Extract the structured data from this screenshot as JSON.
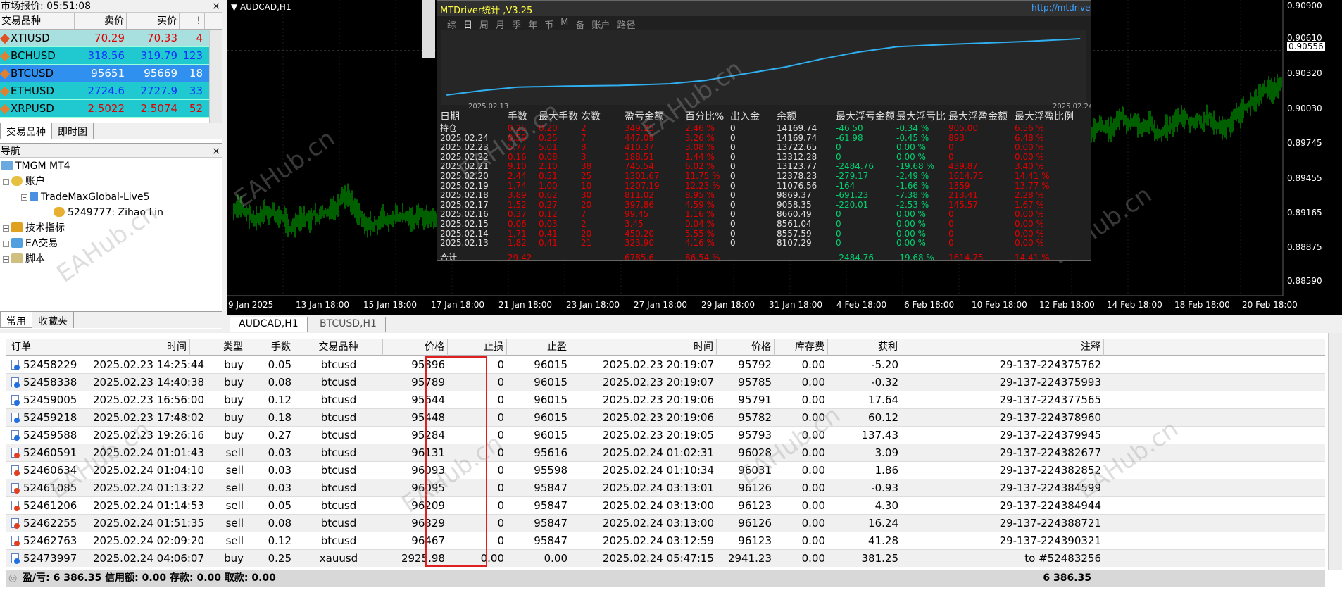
{
  "market_watch": {
    "title": "市场报价: 05:51:08",
    "close": "×",
    "headers": [
      "交易品种",
      "卖价",
      "买价",
      "!"
    ],
    "rows": [
      {
        "symbol": "XTIUSD",
        "bid": "70.29",
        "ask": "70.33",
        "spread": "4",
        "bg": "#a8e0e0",
        "color": "#e00000"
      },
      {
        "symbol": "BCHUSD",
        "bid": "318.56",
        "ask": "319.79",
        "spread": "123",
        "bg": "#20c8d0",
        "color": "#1030ff"
      },
      {
        "symbol": "BTCUSD",
        "bid": "95651",
        "ask": "95669",
        "spread": "18",
        "bg": "#3090f0",
        "color": "#ffffff"
      },
      {
        "symbol": "ETHUSD",
        "bid": "2724.6",
        "ask": "2727.9",
        "spread": "33",
        "bg": "#20c8d0",
        "color": "#1030ff"
      },
      {
        "symbol": "XRPUSD",
        "bid": "2.5022",
        "ask": "2.5074",
        "spread": "52",
        "bg": "#20c8d0",
        "color": "#e00000"
      }
    ],
    "tabs": [
      "交易品种",
      "即时图"
    ]
  },
  "navigator": {
    "title": "导航",
    "close": "×",
    "items": [
      {
        "label": "TMGM MT4"
      },
      {
        "label": "账户"
      },
      {
        "label": "TradeMaxGlobal-Live5"
      },
      {
        "label": "5249777: Zihao Lin"
      },
      {
        "label": "技术指标"
      },
      {
        "label": "EA交易"
      },
      {
        "label": "脚本"
      }
    ],
    "tabs": [
      "常用",
      "收藏夹"
    ]
  },
  "chart": {
    "symbol_label": "AUDCAD,H1",
    "price_scale": [
      "0.90900",
      "0.90610",
      "0.90556",
      "0.90320",
      "0.90030",
      "0.89745",
      "0.89455",
      "0.89165",
      "0.88875",
      "0.88590"
    ],
    "time_scale": [
      "9 Jan 2025",
      "13 Jan 18:00",
      "15 Jan 18:00",
      "17 Jan 18:00",
      "21 Jan 18:00",
      "23 Jan 18:00",
      "27 Jan 18:00",
      "29 Jan 18:00",
      "31 Jan 18:00",
      "4 Feb 18:00",
      "6 Feb 18:00",
      "10 Feb 18:00",
      "12 Feb 18:00",
      "14 Feb 18:00",
      "18 Feb 18:00",
      "20 Feb 18:00"
    ],
    "tabs": [
      "AUDCAD,H1",
      "BTCUSD,H1"
    ],
    "watermark": "EAHub.cn"
  },
  "stats": {
    "title": "MTDriver统计 ,V3.25",
    "link": "http://mtdriver.cn",
    "menu": [
      "综",
      "日",
      "周",
      "月",
      "季",
      "年",
      "币",
      "M",
      "备",
      "账户",
      "路径"
    ],
    "curve_start": "2025.02.13",
    "curve_end": "2025.02.24",
    "headers": [
      "日期",
      "手数",
      "最大手数",
      "次数",
      "盈亏金额",
      "百分比%",
      "出入金",
      "余额",
      "最大浮亏金额",
      "最大浮亏比",
      "最大浮盈金额",
      "最大浮盈比例"
    ],
    "rows": [
      [
        "持仓",
        "0.25",
        "0.20",
        "2",
        "349.25",
        "2.46 %",
        "0",
        "14169.74",
        "-46.50",
        "-0.34 %",
        "905.00",
        "6.56 %"
      ],
      [
        "2025.02.24",
        "0.59",
        "0.25",
        "7",
        "447.09",
        "3.26 %",
        "0",
        "14169.74",
        "-61.98",
        "-0.45 %",
        "893",
        "6.48 %"
      ],
      [
        "2025.02.23",
        "5.77",
        "5.01",
        "8",
        "410.37",
        "3.08 %",
        "0",
        "13722.65",
        "0",
        "0.00 %",
        "0",
        "0.00 %"
      ],
      [
        "2025.02.22",
        "0.16",
        "0.08",
        "3",
        "188.51",
        "1.44 %",
        "0",
        "13312.28",
        "0",
        "0.00 %",
        "0",
        "0.00 %"
      ],
      [
        "2025.02.21",
        "9.10",
        "2.10",
        "38",
        "745.54",
        "6.02 %",
        "0",
        "13123.77",
        "-2484.76",
        "-19.68 %",
        "439.87",
        "3.40 %"
      ],
      [
        "2025.02.20",
        "2.44",
        "0.51",
        "25",
        "1301.67",
        "11.75 %",
        "0",
        "12378.23",
        "-279.17",
        "-2.49 %",
        "1614.75",
        "14.41 %"
      ],
      [
        "2025.02.19",
        "1.74",
        "1.00",
        "10",
        "1207.19",
        "12.23 %",
        "0",
        "11076.56",
        "-164",
        "-1.66 %",
        "1359",
        "13.77 %"
      ],
      [
        "2025.02.18",
        "3.89",
        "0.62",
        "30",
        "811.02",
        "8.95 %",
        "0",
        "9869.37",
        "-691.23",
        "-7.38 %",
        "213.41",
        "2.28 %"
      ],
      [
        "2025.02.17",
        "1.52",
        "0.27",
        "20",
        "397.86",
        "4.59 %",
        "0",
        "9058.35",
        "-220.01",
        "-2.53 %",
        "145.57",
        "1.67 %"
      ],
      [
        "2025.02.16",
        "0.37",
        "0.12",
        "7",
        "99.45",
        "1.16 %",
        "0",
        "8660.49",
        "0",
        "0.00 %",
        "0",
        "0.00 %"
      ],
      [
        "2025.02.15",
        "0.06",
        "0.03",
        "2",
        "3.45",
        "0.04 %",
        "0",
        "8561.04",
        "0",
        "0.00 %",
        "0",
        "0.00 %"
      ],
      [
        "2025.02.14",
        "1.71",
        "0.41",
        "20",
        "450.20",
        "5.55 %",
        "0",
        "8557.59",
        "0",
        "0.00 %",
        "0",
        "0.00 %"
      ],
      [
        "2025.02.13",
        "1.82",
        "0.41",
        "21",
        "323.90",
        "4.16 %",
        "0",
        "8107.29",
        "0",
        "0.00 %",
        "0",
        "0.00 %"
      ]
    ],
    "total": [
      "合计",
      "29.42",
      "",
      "",
      "6785.6",
      "86.54 %",
      "",
      "",
      "-2484.76",
      "-19.68 %",
      "1614.75",
      "14.41 %"
    ]
  },
  "terminal": {
    "headers": [
      "订单",
      "时间",
      "类型",
      "手数",
      "交易品种",
      "价格",
      "止损",
      "止盈",
      "时间",
      "价格",
      "库存费",
      "获利",
      "注释"
    ],
    "rows": [
      [
        "52458229",
        "2025.02.23 14:25:44",
        "buy",
        "0.05",
        "btcusd",
        "95896",
        "0",
        "96015",
        "2025.02.23 20:19:07",
        "95792",
        "0.00",
        "-5.20",
        "29-137-224375762"
      ],
      [
        "52458338",
        "2025.02.23 14:40:38",
        "buy",
        "0.08",
        "btcusd",
        "95789",
        "0",
        "96015",
        "2025.02.23 20:19:07",
        "95785",
        "0.00",
        "-0.32",
        "29-137-224375993"
      ],
      [
        "52459005",
        "2025.02.23 16:56:00",
        "buy",
        "0.12",
        "btcusd",
        "95644",
        "0",
        "96015",
        "2025.02.23 20:19:06",
        "95791",
        "0.00",
        "17.64",
        "29-137-224377565"
      ],
      [
        "52459218",
        "2025.02.23 17:48:02",
        "buy",
        "0.18",
        "btcusd",
        "95448",
        "0",
        "96015",
        "2025.02.23 20:19:06",
        "95782",
        "0.00",
        "60.12",
        "29-137-224378960"
      ],
      [
        "52459588",
        "2025.02.23 19:26:16",
        "buy",
        "0.27",
        "btcusd",
        "95284",
        "0",
        "96015",
        "2025.02.23 20:19:05",
        "95793",
        "0.00",
        "137.43",
        "29-137-224379945"
      ],
      [
        "52460591",
        "2025.02.24 01:01:43",
        "sell",
        "0.03",
        "btcusd",
        "96131",
        "0",
        "95616",
        "2025.02.24 01:02:31",
        "96028",
        "0.00",
        "3.09",
        "29-137-224382677"
      ],
      [
        "52460634",
        "2025.02.24 01:04:10",
        "sell",
        "0.03",
        "btcusd",
        "96093",
        "0",
        "95598",
        "2025.02.24 01:10:34",
        "96031",
        "0.00",
        "1.86",
        "29-137-224382852"
      ],
      [
        "52461085",
        "2025.02.24 01:13:22",
        "sell",
        "0.03",
        "btcusd",
        "96095",
        "0",
        "95847",
        "2025.02.24 03:13:01",
        "96126",
        "0.00",
        "-0.93",
        "29-137-224384599"
      ],
      [
        "52461206",
        "2025.02.24 01:14:53",
        "sell",
        "0.05",
        "btcusd",
        "96209",
        "0",
        "95847",
        "2025.02.24 03:13:00",
        "96123",
        "0.00",
        "4.30",
        "29-137-224384944"
      ],
      [
        "52462255",
        "2025.02.24 01:51:35",
        "sell",
        "0.08",
        "btcusd",
        "96329",
        "0",
        "95847",
        "2025.02.24 03:13:00",
        "96126",
        "0.00",
        "16.24",
        "29-137-224388721"
      ],
      [
        "52462763",
        "2025.02.24 02:09:20",
        "sell",
        "0.12",
        "btcusd",
        "96467",
        "0",
        "95847",
        "2025.02.24 03:12:59",
        "96123",
        "0.00",
        "41.28",
        "29-137-224390321"
      ],
      [
        "52473997",
        "2025.02.24 04:06:07",
        "buy",
        "0.25",
        "xauusd",
        "2925.98",
        "0.00",
        "0.00",
        "2025.02.24 05:47:15",
        "2941.23",
        "0.00",
        "381.25",
        "to #52483256"
      ]
    ],
    "footer_summary": "盈/亏: 6 386.35  信用额: 0.00  存款: 0.00  取款: 0.00",
    "footer_total": "6 386.35"
  }
}
